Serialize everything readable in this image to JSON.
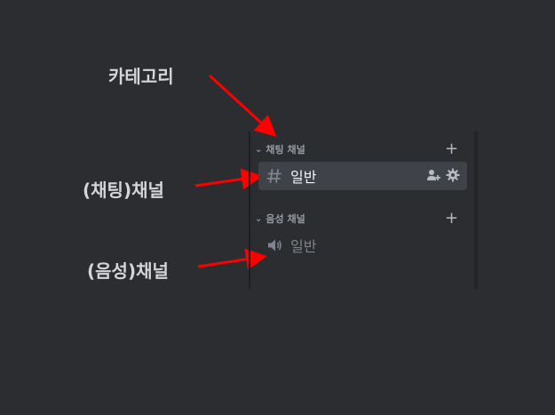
{
  "annotations": {
    "category": "카테고리",
    "text_channel": "(채팅)채널",
    "voice_channel": "(음성)채널"
  },
  "sidebar": {
    "categories": [
      {
        "label": "채팅 채널",
        "channels": [
          {
            "name": "일반",
            "type": "text",
            "icon": "hash-icon",
            "selected": true,
            "actions": [
              "invite-icon",
              "gear-icon"
            ]
          }
        ]
      },
      {
        "label": "음성 채널",
        "channels": [
          {
            "name": "일반",
            "type": "voice",
            "icon": "speaker-icon",
            "selected": false
          }
        ]
      }
    ]
  },
  "colors": {
    "background": "#2b2d31",
    "selected_row": "#404249",
    "arrow": "#ff0000",
    "muted_text": "#949ba4"
  }
}
